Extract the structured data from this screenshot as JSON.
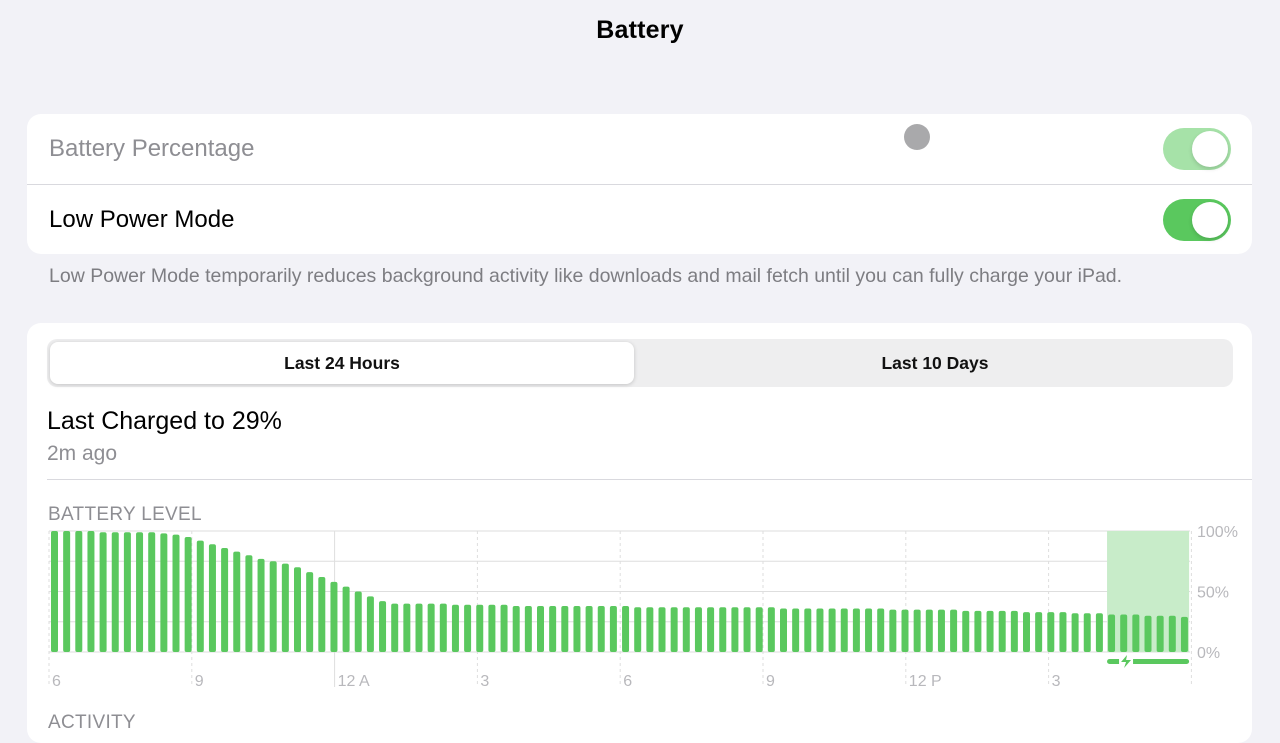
{
  "header": {
    "title": "Battery"
  },
  "settings": [
    {
      "label": "Battery Percentage",
      "toggle_on": true
    },
    {
      "label": "Low Power Mode",
      "toggle_on": true
    }
  ],
  "footnote": "Low Power Mode temporarily reduces background activity like downloads and mail fetch until you can fully charge your iPad.",
  "usage": {
    "segments": [
      "Last 24 Hours",
      "Last 10 Days"
    ],
    "selected_segment": "Last 24 Hours",
    "last_charged_title": "Last Charged to 29%",
    "last_charged_time": "2m ago",
    "battery_level_caption": "BATTERY LEVEL",
    "activity_caption": "ACTIVITY"
  },
  "colors": {
    "accent_green": "#5ac85e",
    "charging_band": "#c8ecc9",
    "grid": "#dedede"
  },
  "chart_data": {
    "type": "bar",
    "title": "BATTERY LEVEL",
    "y_tick_labels": [
      "100%",
      "50%",
      "0%"
    ],
    "ylim": [
      0,
      100
    ],
    "x_tick_labels": [
      "6",
      "9",
      "12 A",
      "3",
      "6",
      "9",
      "12 P",
      "3"
    ],
    "values": [
      100,
      100,
      100,
      100,
      99,
      99,
      99,
      99,
      99,
      98,
      97,
      95,
      92,
      89,
      86,
      83,
      80,
      77,
      75,
      73,
      70,
      66,
      62,
      58,
      54,
      50,
      46,
      42,
      40,
      40,
      40,
      40,
      40,
      39,
      39,
      39,
      39,
      39,
      38,
      38,
      38,
      38,
      38,
      38,
      38,
      38,
      38,
      38,
      37,
      37,
      37,
      37,
      37,
      37,
      37,
      37,
      37,
      37,
      37,
      37,
      36,
      36,
      36,
      36,
      36,
      36,
      36,
      36,
      36,
      35,
      35,
      35,
      35,
      35,
      35,
      34,
      34,
      34,
      34,
      34,
      33,
      33,
      33,
      33,
      32,
      32,
      32,
      31,
      31,
      31,
      30,
      30,
      30,
      29
    ],
    "charging_from_index": 87,
    "grid": true
  }
}
